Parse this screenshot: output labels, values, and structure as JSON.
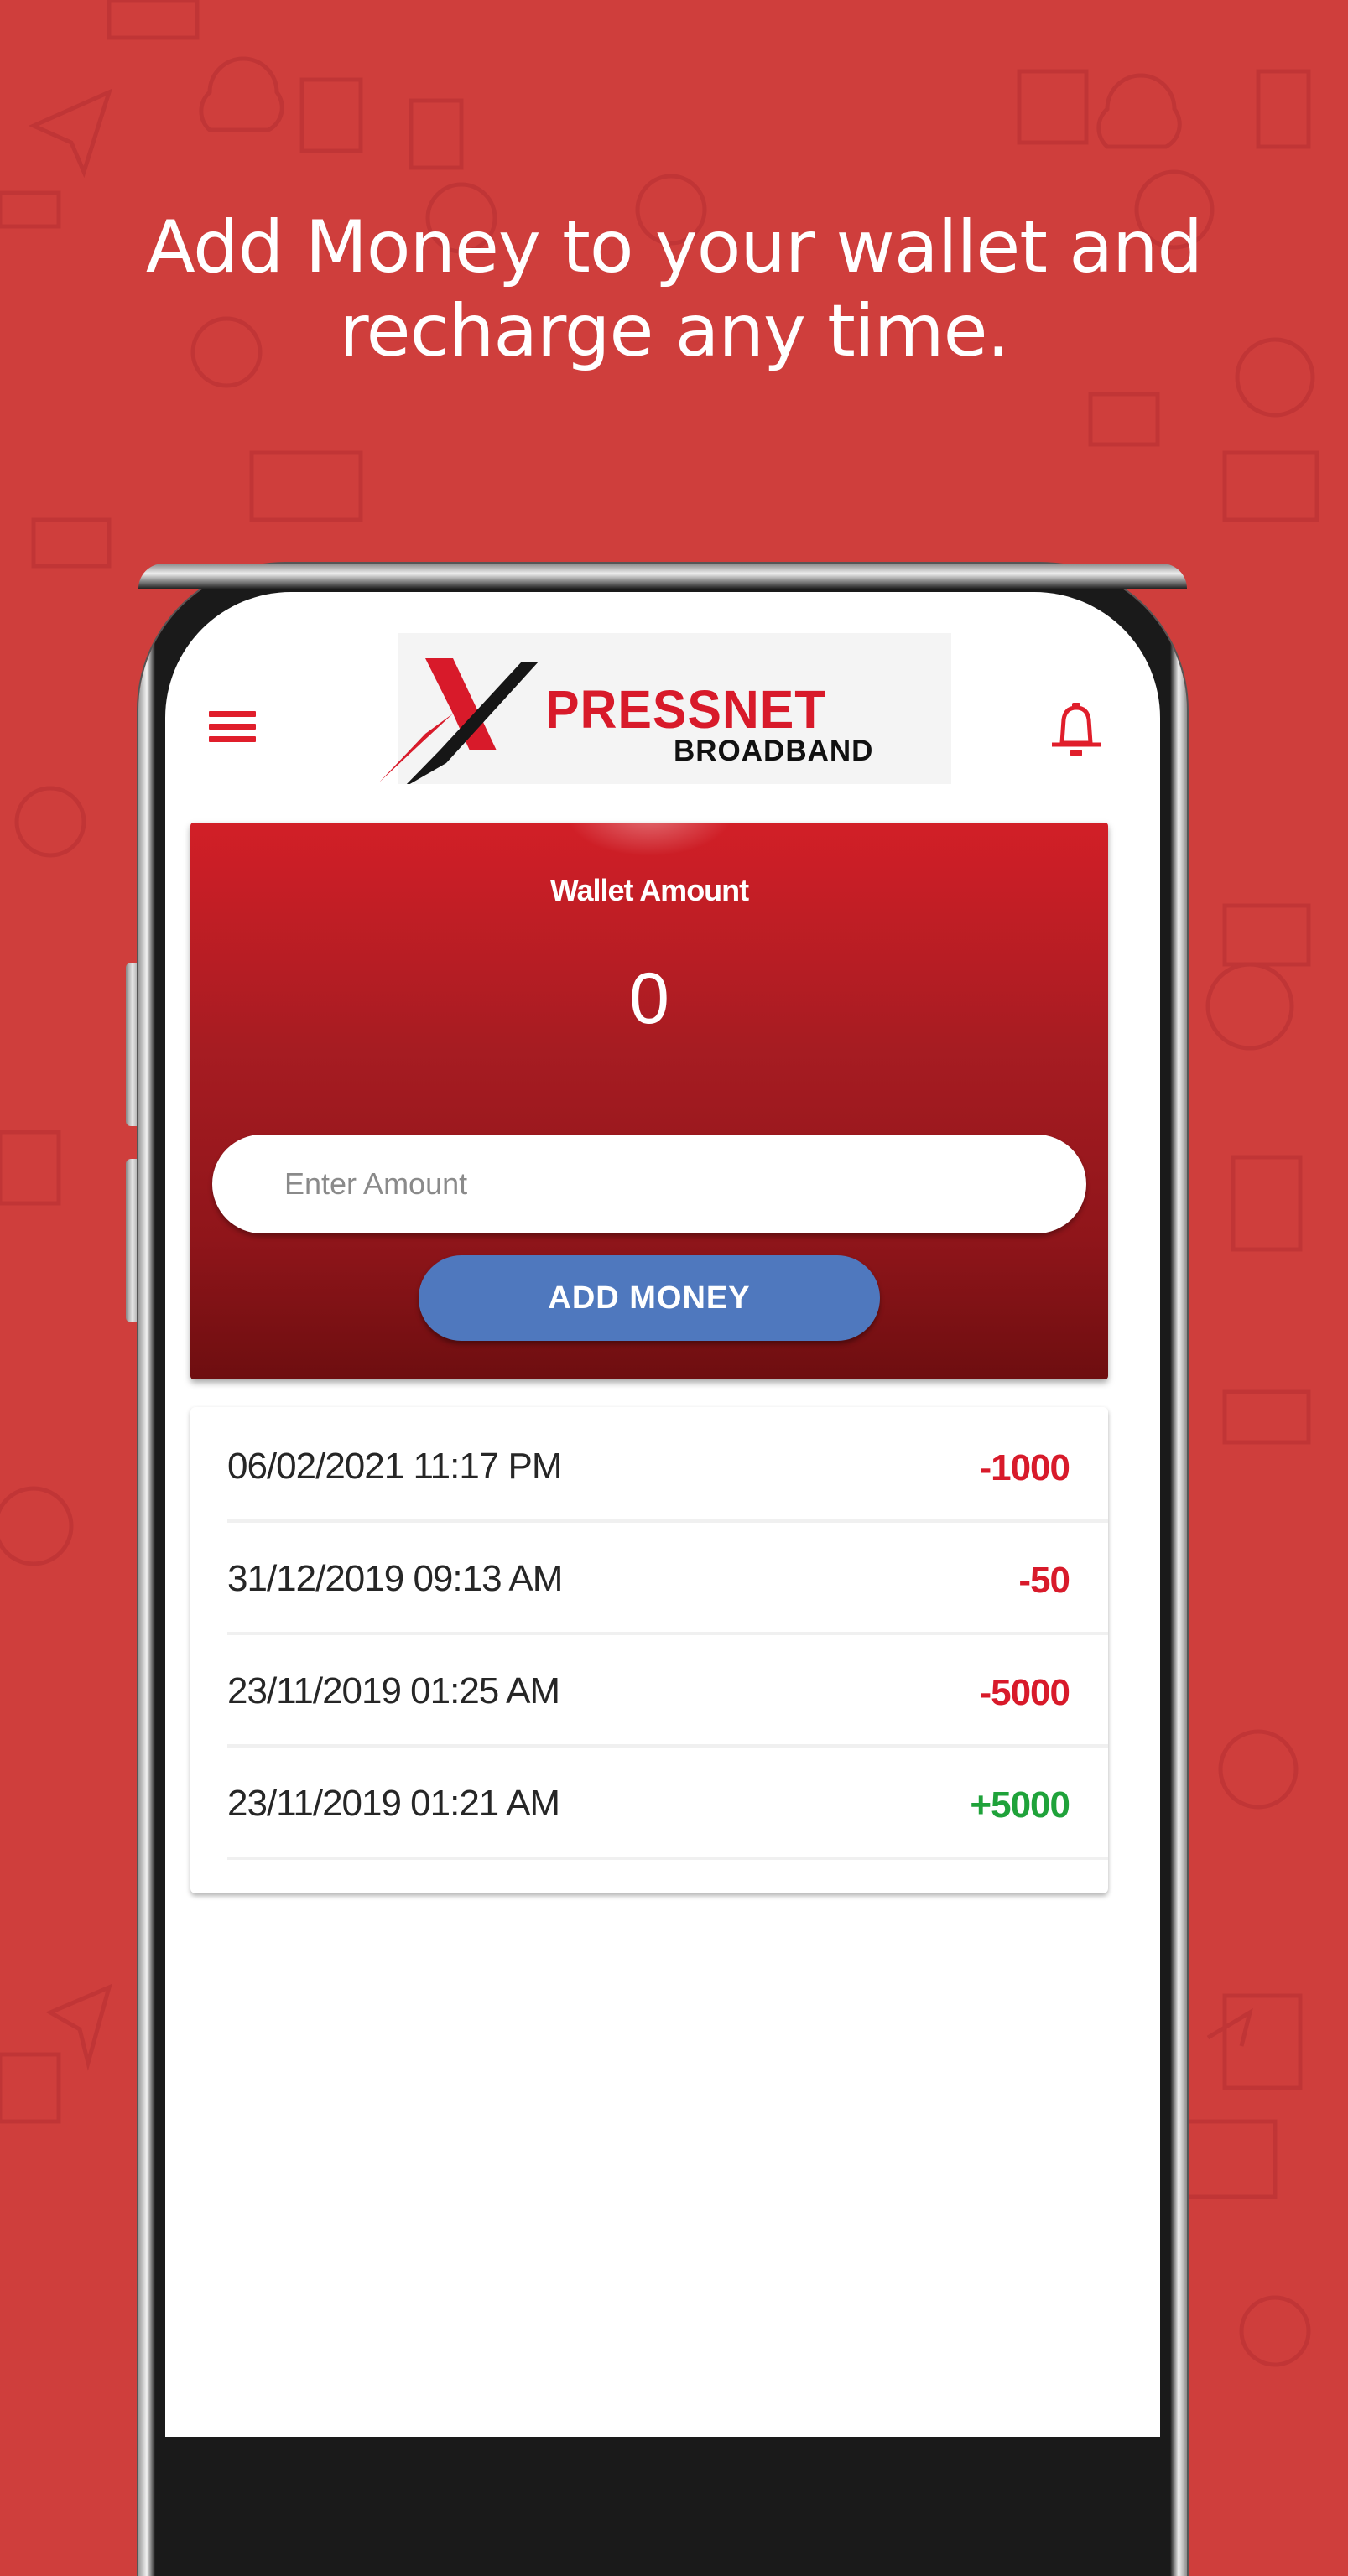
{
  "headline": {
    "line1": "Add Money to your wallet and",
    "line2": "recharge any time."
  },
  "colors": {
    "background": "#cf3e3c",
    "brand_red": "#d81a2a",
    "button_blue": "#4f78be",
    "debit": "#d81a2a",
    "credit": "#1fa23a"
  },
  "app": {
    "header": {
      "menu_icon": "hamburger-menu-icon",
      "logo": {
        "word": "PRESSNET",
        "subtitle": "BROADBAND"
      },
      "notification_icon": "bell-icon"
    },
    "wallet": {
      "label": "Wallet Amount",
      "amount": "0",
      "input_placeholder": "Enter Amount",
      "input_value": "",
      "button_label": "ADD MONEY"
    },
    "transactions": [
      {
        "datetime": "06/02/2021 11:17 PM",
        "amount": "-1000",
        "type": "debit"
      },
      {
        "datetime": "31/12/2019 09:13 AM",
        "amount": "-50",
        "type": "debit"
      },
      {
        "datetime": "23/11/2019 01:25 AM",
        "amount": "-5000",
        "type": "debit"
      },
      {
        "datetime": "23/11/2019 01:21 AM",
        "amount": "+5000",
        "type": "credit"
      }
    ]
  }
}
